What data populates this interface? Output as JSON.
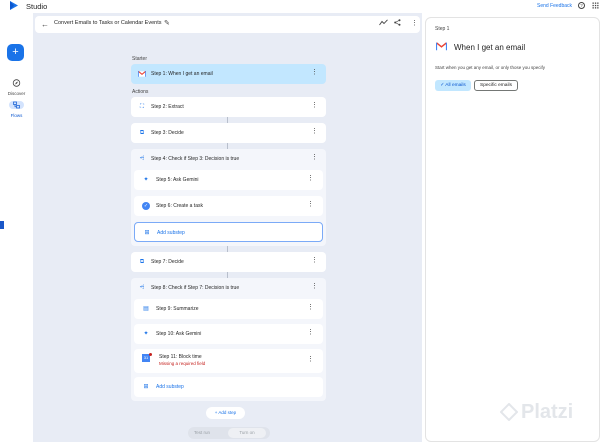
{
  "app": {
    "title": "Studio",
    "send_feedback": "Send Feedback"
  },
  "rail": {
    "add_label": "+",
    "discover": "Discover",
    "flows": "Flows"
  },
  "header": {
    "flow_title": "Convert Emails to Tasks or Calendar Events"
  },
  "sections": {
    "starter": "Starter",
    "actions": "Actions"
  },
  "steps": {
    "s1": "Step 1: When I get an email",
    "s2": "Step 2: Extract",
    "s3": "Step 3: Decide",
    "s4": "Step 4: Check if Step 3: Decision is true",
    "s5": "Step 5: Ask Gemini",
    "s6": "Step 6: Create a task",
    "add_substep_1": "Add substep",
    "s7": "Step 7: Decide",
    "s8": "Step 8: Check if Step 7: Decision is true",
    "s9": "Step 9: Summarize",
    "s10": "Step 10: Ask Gemini",
    "s11": "Step 11: Block time",
    "s11_error": "Missing a required field",
    "add_substep_2": "Add substep"
  },
  "footer": {
    "add_step": "+ Add step",
    "test_run": "Test run",
    "turn_on": "Turn on"
  },
  "panel": {
    "step": "Step 1",
    "title": "When I get an email",
    "description": "Start when you get any email, or only those you specify",
    "chip_all": "✓ All emails",
    "chip_specific": "Specific emails"
  },
  "watermark": "Platzi",
  "colors": {
    "accent": "#1a73e8",
    "selected": "#c2e7ff",
    "canvas": "#e8ecf5",
    "error": "#c5221f"
  }
}
